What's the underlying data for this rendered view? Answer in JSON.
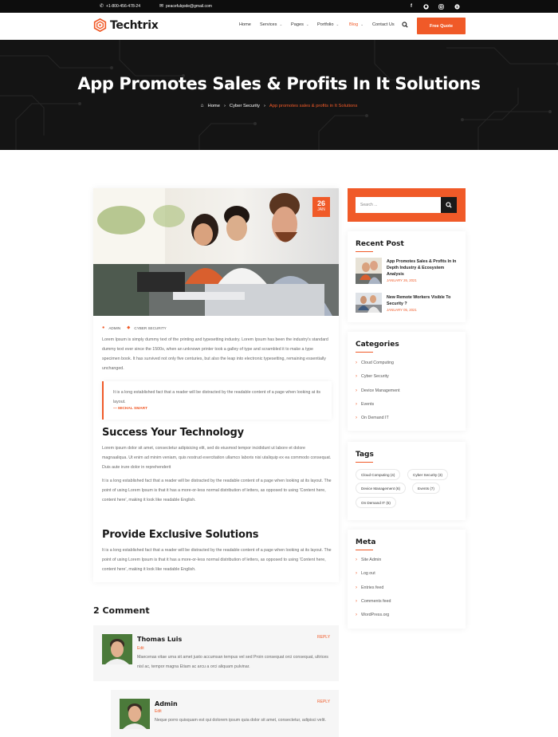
{
  "topbar": {
    "phone": "+1-800-456-478-24",
    "email": "peacefulqode@gmail.com",
    "social_icons": [
      "facebook-icon",
      "github-icon",
      "instagram-icon",
      "skype-icon"
    ]
  },
  "brand": {
    "name": "Techtrix",
    "accent": "#f05a28"
  },
  "nav": {
    "items": [
      {
        "label": "Home",
        "dropdown": false
      },
      {
        "label": "Services",
        "dropdown": true
      },
      {
        "label": "Pages",
        "dropdown": true
      },
      {
        "label": "Portfolio",
        "dropdown": true
      },
      {
        "label": "Blog",
        "dropdown": true,
        "active": true
      },
      {
        "label": "Contact Us",
        "dropdown": false
      }
    ],
    "cta": "Free Quote"
  },
  "hero": {
    "title": "App Promotes Sales & Profits In It Solutions",
    "breadcrumb": [
      "Home",
      "Cyber Security",
      "App promotes sales & profits in It Solutions"
    ]
  },
  "post": {
    "date_day": "26",
    "date_month": "JAN",
    "author": "ADMIN",
    "category": "CYBER SECURITY",
    "intro": "Lorem Ipsum is simply dummy text of the printing and typesetting industry. Lorem Ipsum has been the industry's standard dummy text ever since the 1500s, when an unknown printer took a galley of type and scrambled it to make a type specimen book. It has survived not only five centuries, but also the leap into electronic typesetting, remaining essentially unchanged.",
    "quote": "It is a long established fact that a reader will be distracted by the readable content of a page when looking at its layout.",
    "quote_author": "— MICHAL SMART",
    "section1_title": "Success Your Technology",
    "section1_p1": "Lorem ipsum dolor sit amet, consectetur adipisicing elit, sed do eiusmod tempor incididunt ut labore et dolore magnaaliqua. Ut enim ad minim veniam, quis nostrud exercitation ullamco laboris nisi utaliquip ex ea commodo consequat. Duis aute irure dolor in reprehenderit",
    "section1_p2": "It is a long established fact that a reader will be distracted by the readable content of a page when looking at its layout. The point of using Lorem Ipsum is that it has a more-or-less normal distribution of letters, as opposed to using 'Content here, content here', making it look like readable English.",
    "section2_title": "Provide Exclusive Solutions",
    "section2_p1": "It is a long established fact that a reader will be distracted by the readable content of a page when looking at its layout. The point of using Lorem Ipsum is that it has a more-or-less normal distribution of letters, as opposed to using 'Content here, content here', making it look like readable English."
  },
  "comments": {
    "title": "2 Comment",
    "items": [
      {
        "name": "Thomas Luis",
        "edit": "Edit",
        "reply": "REPLY",
        "text": "Maecenas vitae urna sit amet justo accumsan tempus vel sed Proin consequat orci consequat, ultrices nisl ac, tempor magna Etiam ac arcu a orci aliquam pulvinar."
      },
      {
        "name": "Admin",
        "edit": "Edit",
        "reply": "REPLY",
        "text": "Neque porro quisquam est qui dolorem ipsum quia dolor sit amet, consectetur, adipisci velit."
      }
    ]
  },
  "sidebar": {
    "search_placeholder": "Search ...",
    "recent": {
      "title": "Recent Post",
      "items": [
        {
          "title": "App Promotes Sales & Profits In In Depth Industry & Ecosystem Analysis",
          "date": "JANUARY 26, 2021"
        },
        {
          "title": "New Remote Workers Visible To Security ?",
          "date": "JANUARY 05, 2021"
        }
      ]
    },
    "categories": {
      "title": "Categories",
      "items": [
        "Cloud Computing",
        "Cyber Security",
        "Device Management",
        "Events",
        "On Demand IT"
      ]
    },
    "tags": {
      "title": "Tags",
      "items": [
        "Cloud Computing (4)",
        "Cyber Security (3)",
        "Device Management (6)",
        "Events (7)",
        "On Demand IT (5)"
      ]
    },
    "meta": {
      "title": "Meta",
      "items": [
        "Site Admin",
        "Log out",
        "Entries feed",
        "Comments feed",
        "WordPress.org"
      ]
    }
  }
}
